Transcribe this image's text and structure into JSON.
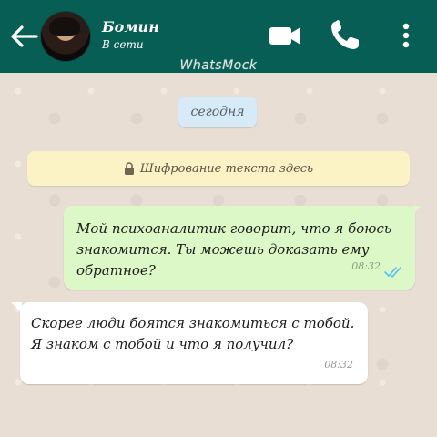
{
  "header": {
    "contact_name": "Бомин",
    "status": "В сети",
    "watermark": "WhatsMock",
    "icons": [
      "back-arrow-icon",
      "video-call-icon",
      "phone-icon",
      "more-vert-icon"
    ]
  },
  "chat": {
    "date_label": "сегодня",
    "encryption_notice": "Шифрование текста здесь",
    "messages": [
      {
        "direction": "outgoing",
        "text": "Мой психоаналитик говорит, что я боюсь знакомится. Ты можешь доказать ему обратное?",
        "time": "08:32",
        "status": "read"
      },
      {
        "direction": "incoming",
        "text": "Скорее люди боятся знакомиться с тобой. Я знаком с тобой и что я получил?",
        "time": "08:32"
      }
    ]
  },
  "colors": {
    "header": "#075e54",
    "outgoing_bubble": "#dcf8c6",
    "incoming_bubble": "#ffffff",
    "read_ticks": "#4fc3f7",
    "date_chip": "#d6eaf7",
    "encryption_banner": "#fbf2c5"
  }
}
